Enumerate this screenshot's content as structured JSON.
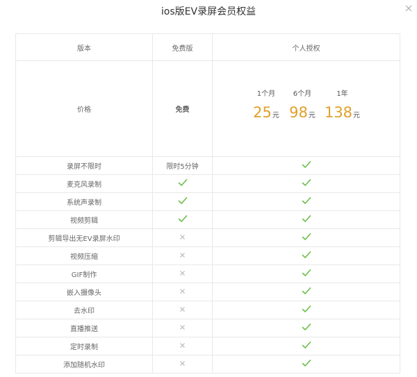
{
  "dialog": {
    "title": "ios版EV录屏会员权益",
    "close_icon": "close-icon"
  },
  "table": {
    "headers": [
      "版本",
      "免费版",
      "个人授权"
    ],
    "price_row": {
      "label": "价格",
      "free": "免费",
      "plans": [
        {
          "period": "1个月",
          "amount": "25",
          "unit": "元"
        },
        {
          "period": "6个月",
          "amount": "98",
          "unit": "元"
        },
        {
          "period": "1年",
          "amount": "138",
          "unit": "元"
        }
      ]
    },
    "features": [
      {
        "name": "录屏不限时",
        "free": "限时5分钟",
        "personal": "check"
      },
      {
        "name": "麦克风录制",
        "free": "check",
        "personal": "check"
      },
      {
        "name": "系统声录制",
        "free": "check",
        "personal": "check"
      },
      {
        "name": "视频剪辑",
        "free": "check",
        "personal": "check"
      },
      {
        "name": "剪辑导出无EV录屏水印",
        "free": "cross",
        "personal": "check"
      },
      {
        "name": "视频压缩",
        "free": "cross",
        "personal": "check"
      },
      {
        "name": "GIF制作",
        "free": "cross",
        "personal": "check"
      },
      {
        "name": "嵌入摄像头",
        "free": "cross",
        "personal": "check"
      },
      {
        "name": "去水印",
        "free": "cross",
        "personal": "check"
      },
      {
        "name": "直播推送",
        "free": "cross",
        "personal": "check"
      },
      {
        "name": "定时录制",
        "free": "cross",
        "personal": "check"
      },
      {
        "name": "添加随机水印",
        "free": "cross",
        "personal": "check"
      }
    ]
  },
  "colors": {
    "price_accent": "#e0a02a",
    "check": "#6cbf4b",
    "cross": "#b5b5b5",
    "border": "#e8e8e8"
  },
  "icons": {
    "check": "check-icon",
    "cross": "cross-icon"
  }
}
